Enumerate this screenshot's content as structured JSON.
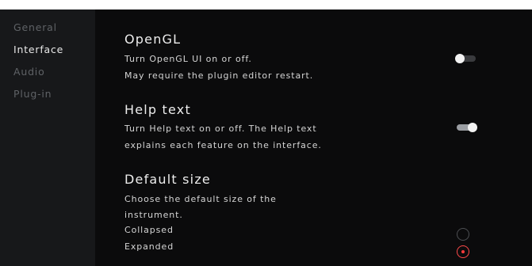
{
  "sidebar": {
    "items": [
      {
        "label": "General",
        "active": false
      },
      {
        "label": "Interface",
        "active": true
      },
      {
        "label": "Audio",
        "active": false
      },
      {
        "label": "Plug-in",
        "active": false
      }
    ]
  },
  "sections": {
    "opengl": {
      "title": "OpenGL",
      "desc_line1": "Turn OpenGL UI on or off.",
      "desc_line2": "May require the plugin editor restart.",
      "toggle_state": "off"
    },
    "help_text": {
      "title": "Help text",
      "desc_line1": "Turn Help text on or off. The Help text",
      "desc_line2": "explains each feature on the interface.",
      "toggle_state": "on"
    },
    "default_size": {
      "title": "Default size",
      "desc_line1": "Choose the default size of the",
      "desc_line2": "instrument.",
      "options": [
        {
          "label": "Collapsed",
          "selected": false
        },
        {
          "label": "Expanded",
          "selected": true
        }
      ]
    }
  },
  "colors": {
    "background": "#0b0b0c",
    "sidebar": "#17181a",
    "accent_red": "#ff3b3b",
    "toggle_on_track": "#9b9ea3",
    "toggle_off_track": "#3a3b3e"
  }
}
